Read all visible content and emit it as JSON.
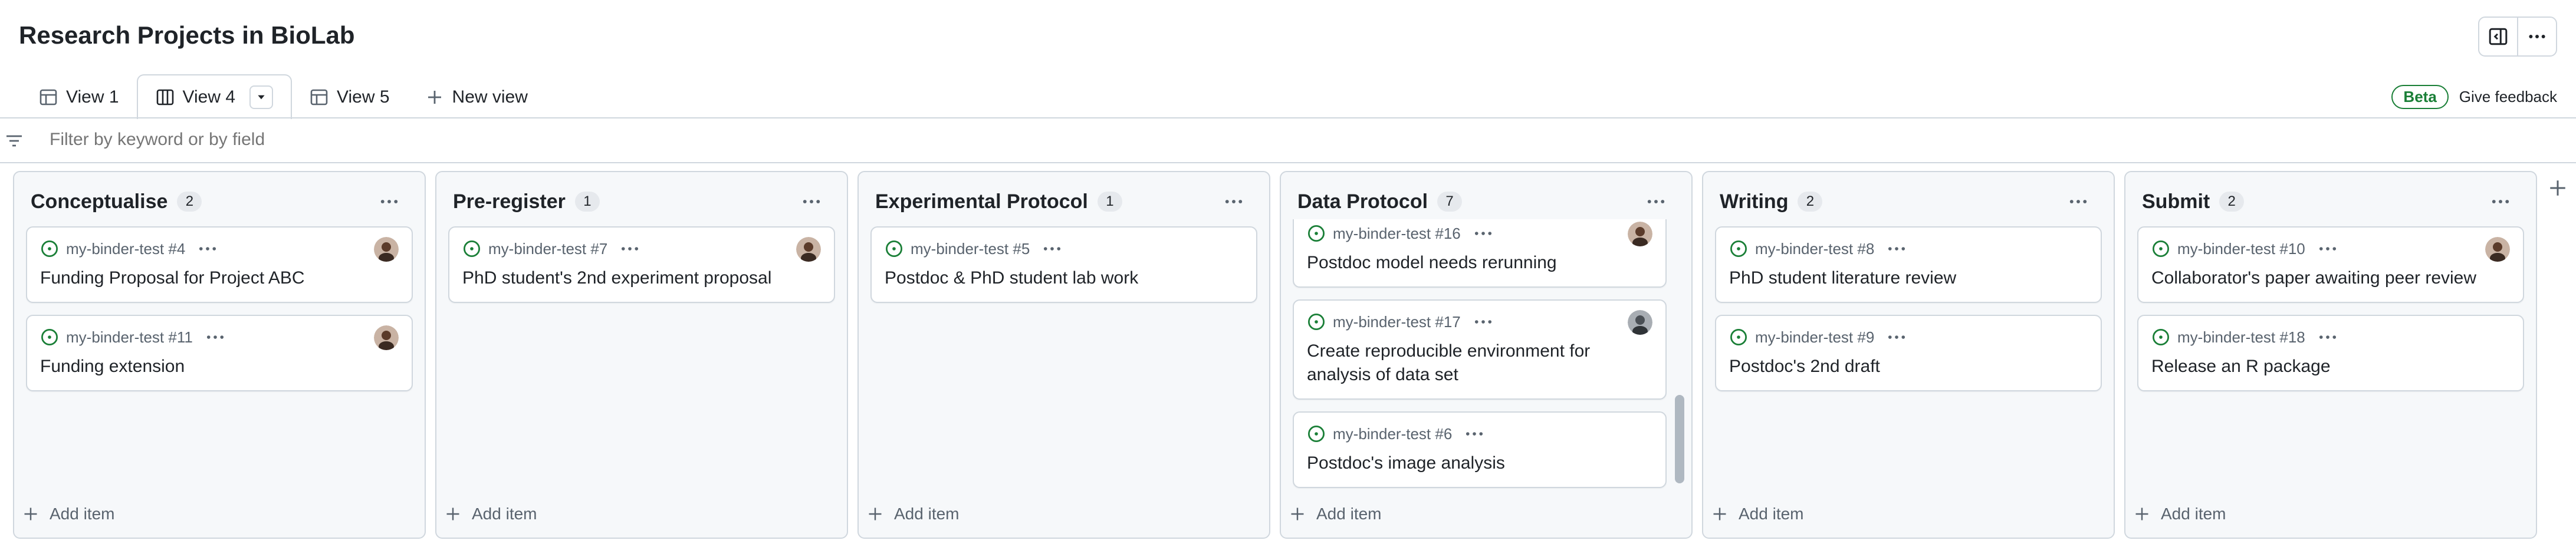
{
  "project": {
    "title": "Research Projects in BioLab"
  },
  "tabs": [
    {
      "label": "View 1",
      "icon": "table-icon"
    },
    {
      "label": "View 4",
      "icon": "board-icon",
      "active": true
    },
    {
      "label": "View 5",
      "icon": "table-icon"
    },
    {
      "label": "New view",
      "icon": "plus-icon"
    }
  ],
  "beta": {
    "badge": "Beta",
    "feedback": "Give feedback"
  },
  "filter": {
    "placeholder": "Filter by keyword or by field"
  },
  "columns": [
    {
      "title": "Conceptualise",
      "count": "2",
      "cards": [
        {
          "ref": "my-binder-test #4",
          "title": "Funding Proposal for Project ABC",
          "avatar": "avatar-a"
        },
        {
          "ref": "my-binder-test #11",
          "title": "Funding extension",
          "avatar": "avatar-a"
        }
      ]
    },
    {
      "title": "Pre-register",
      "count": "1",
      "cards": [
        {
          "ref": "my-binder-test #7",
          "title": "PhD student's 2nd experiment proposal",
          "avatar": "avatar-a"
        }
      ]
    },
    {
      "title": "Experimental Protocol",
      "count": "1",
      "cards": [
        {
          "ref": "my-binder-test #5",
          "title": "Postdoc & PhD student lab work",
          "avatar": ""
        }
      ]
    },
    {
      "title": "Data Protocol",
      "count": "7",
      "cards": [
        {
          "ref": "my-binder-test #16",
          "title": "Postdoc model needs rerunning",
          "avatar": "avatar-a"
        },
        {
          "ref": "my-binder-test #17",
          "title": "Create reproducible environment for analysis of data set",
          "avatar": "avatar-b"
        },
        {
          "ref": "my-binder-test #6",
          "title": "Postdoc's image analysis",
          "avatar": ""
        }
      ]
    },
    {
      "title": "Writing",
      "count": "2",
      "cards": [
        {
          "ref": "my-binder-test #8",
          "title": "PhD student literature review",
          "avatar": ""
        },
        {
          "ref": "my-binder-test #9",
          "title": "Postdoc's 2nd draft",
          "avatar": ""
        }
      ]
    },
    {
      "title": "Submit",
      "count": "2",
      "cards": [
        {
          "ref": "my-binder-test #10",
          "title": "Collaborator's paper awaiting peer review",
          "avatar": "avatar-a"
        },
        {
          "ref": "my-binder-test #18",
          "title": "Release an R package",
          "avatar": ""
        }
      ]
    }
  ],
  "add_item_label": "Add item",
  "colors": {
    "open_issue": "#1a7f37",
    "border": "#d0d7de",
    "column_bg": "#f6f8fa"
  }
}
